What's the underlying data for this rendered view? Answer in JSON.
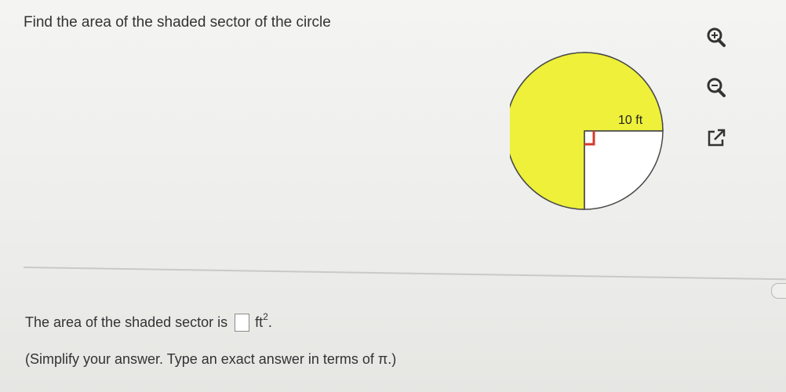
{
  "question": {
    "text": "Find the area of the shaded sector of the circle"
  },
  "figure": {
    "radius_label": "10 ft",
    "shaded_color": "#eef03a",
    "right_angle_color": "#d33a2c"
  },
  "tools": [
    {
      "name": "zoom-in-icon"
    },
    {
      "name": "zoom-out-icon"
    },
    {
      "name": "popout-icon"
    }
  ],
  "answer": {
    "prefix": "The area of the shaded sector is",
    "unit": "ft",
    "unit_exponent": "2",
    "suffix": ".",
    "value": ""
  },
  "hint": {
    "text": "(Simplify your answer. Type an exact answer in terms of π.)"
  }
}
